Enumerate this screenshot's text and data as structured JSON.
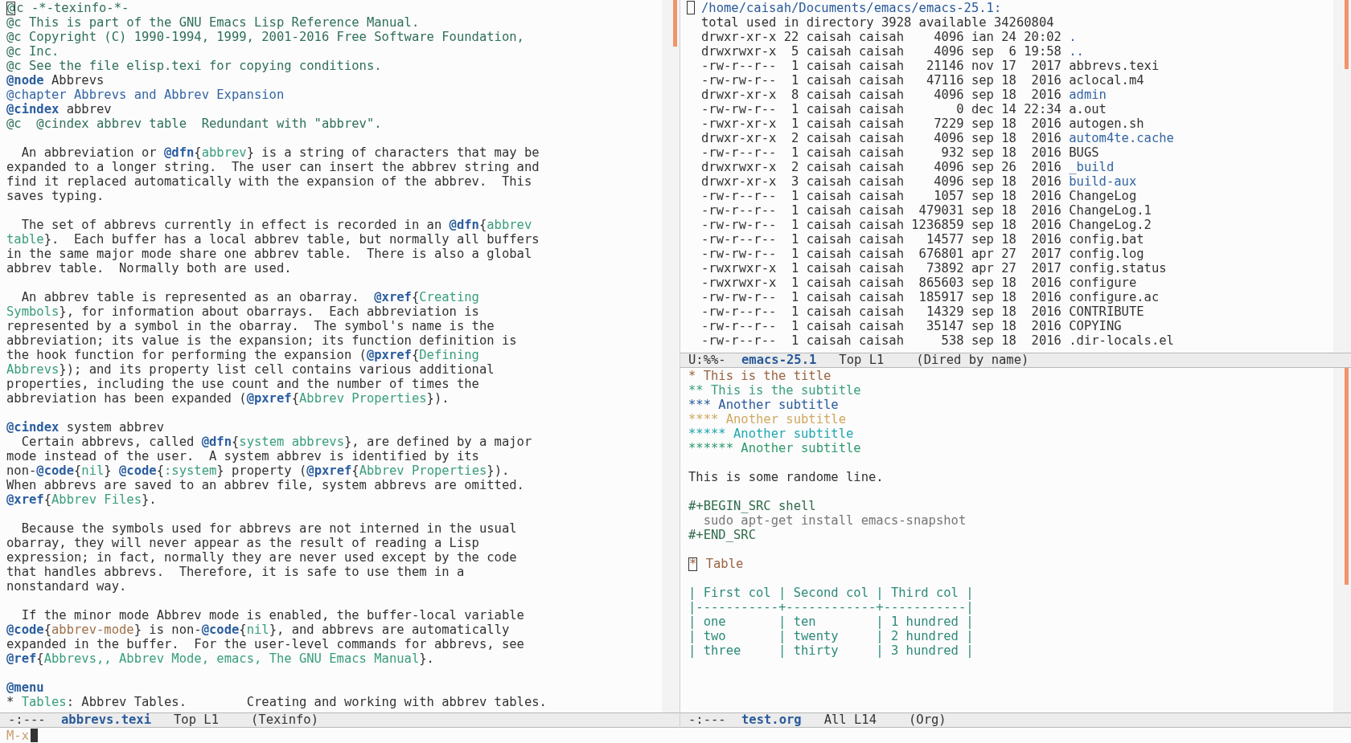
{
  "left": {
    "lines": [
      {
        "kind": "text",
        "segments": [
          {
            "kind": "cursor",
            "text": "@"
          },
          {
            "kind": "comment",
            "text": "c -*-texinfo-*-"
          }
        ]
      },
      {
        "kind": "text",
        "segments": [
          {
            "kind": "comment",
            "text": "@c This is part of the GNU Emacs Lisp Reference Manual."
          }
        ]
      },
      {
        "kind": "text",
        "segments": [
          {
            "kind": "comment",
            "text": "@c Copyright (C) 1990-1994, 1999, 2001-2016 Free Software Foundation,"
          }
        ]
      },
      {
        "kind": "text",
        "segments": [
          {
            "kind": "comment",
            "text": "@c Inc."
          }
        ]
      },
      {
        "kind": "text",
        "segments": [
          {
            "kind": "comment",
            "text": "@c See the file elisp.texi for copying conditions."
          }
        ]
      },
      {
        "kind": "text",
        "segments": [
          {
            "kind": "keyword",
            "text": "@node"
          },
          {
            "kind": "plain",
            "text": " Abbrevs"
          }
        ]
      },
      {
        "kind": "text",
        "segments": [
          {
            "kind": "heading",
            "text": "@chapter Abbrevs and Abbrev Expansion"
          }
        ]
      },
      {
        "kind": "text",
        "segments": [
          {
            "kind": "keyword",
            "text": "@cindex"
          },
          {
            "kind": "plain",
            "text": " abbrev"
          }
        ]
      },
      {
        "kind": "text",
        "segments": [
          {
            "kind": "comment",
            "text": "@c  @cindex abbrev table  Redundant with \"abbrev\"."
          }
        ]
      },
      {
        "kind": "blank"
      },
      {
        "kind": "text",
        "segments": [
          {
            "kind": "plain",
            "text": "  An abbreviation or "
          },
          {
            "kind": "keyword",
            "text": "@dfn"
          },
          {
            "kind": "plain",
            "text": "{"
          },
          {
            "kind": "arg",
            "text": "abbrev"
          },
          {
            "kind": "plain",
            "text": "} is a string of characters that may be"
          }
        ]
      },
      {
        "kind": "text",
        "segments": [
          {
            "kind": "plain",
            "text": "expanded to a longer string.  The user can insert the abbrev string and"
          }
        ]
      },
      {
        "kind": "text",
        "segments": [
          {
            "kind": "plain",
            "text": "find it replaced automatically with the expansion of the abbrev.  This"
          }
        ]
      },
      {
        "kind": "text",
        "segments": [
          {
            "kind": "plain",
            "text": "saves typing."
          }
        ]
      },
      {
        "kind": "blank"
      },
      {
        "kind": "text",
        "segments": [
          {
            "kind": "plain",
            "text": "  The set of abbrevs currently in effect is recorded in an "
          },
          {
            "kind": "keyword",
            "text": "@dfn"
          },
          {
            "kind": "plain",
            "text": "{"
          },
          {
            "kind": "arg",
            "text": "abbrev"
          }
        ]
      },
      {
        "kind": "text",
        "segments": [
          {
            "kind": "arg",
            "text": "table"
          },
          {
            "kind": "plain",
            "text": "}.  Each buffer has a local abbrev table, but normally all buffers"
          }
        ]
      },
      {
        "kind": "text",
        "segments": [
          {
            "kind": "plain",
            "text": "in the same major mode share one abbrev table.  There is also a global"
          }
        ]
      },
      {
        "kind": "text",
        "segments": [
          {
            "kind": "plain",
            "text": "abbrev table.  Normally both are used."
          }
        ]
      },
      {
        "kind": "blank"
      },
      {
        "kind": "text",
        "segments": [
          {
            "kind": "plain",
            "text": "  An abbrev table is represented as an obarray.  "
          },
          {
            "kind": "keyword",
            "text": "@xref"
          },
          {
            "kind": "plain",
            "text": "{"
          },
          {
            "kind": "arg",
            "text": "Creating"
          }
        ]
      },
      {
        "kind": "text",
        "segments": [
          {
            "kind": "arg",
            "text": "Symbols"
          },
          {
            "kind": "plain",
            "text": "}, for information about obarrays.  Each abbreviation is"
          }
        ]
      },
      {
        "kind": "text",
        "segments": [
          {
            "kind": "plain",
            "text": "represented by a symbol in the obarray.  The symbol's name is the"
          }
        ]
      },
      {
        "kind": "text",
        "segments": [
          {
            "kind": "plain",
            "text": "abbreviation; its value is the expansion; its function definition is"
          }
        ]
      },
      {
        "kind": "text",
        "segments": [
          {
            "kind": "plain",
            "text": "the hook function for performing the expansion ("
          },
          {
            "kind": "keyword",
            "text": "@pxref"
          },
          {
            "kind": "plain",
            "text": "{"
          },
          {
            "kind": "arg",
            "text": "Defining"
          }
        ]
      },
      {
        "kind": "text",
        "segments": [
          {
            "kind": "arg",
            "text": "Abbrevs"
          },
          {
            "kind": "plain",
            "text": "}); and its property list cell contains various additional"
          }
        ]
      },
      {
        "kind": "text",
        "segments": [
          {
            "kind": "plain",
            "text": "properties, including the use count and the number of times the"
          }
        ]
      },
      {
        "kind": "text",
        "segments": [
          {
            "kind": "plain",
            "text": "abbreviation has been expanded ("
          },
          {
            "kind": "keyword",
            "text": "@pxref"
          },
          {
            "kind": "plain",
            "text": "{"
          },
          {
            "kind": "arg",
            "text": "Abbrev Properties"
          },
          {
            "kind": "plain",
            "text": "})."
          }
        ]
      },
      {
        "kind": "blank"
      },
      {
        "kind": "text",
        "segments": [
          {
            "kind": "keyword",
            "text": "@cindex"
          },
          {
            "kind": "plain",
            "text": " system abbrev"
          }
        ]
      },
      {
        "kind": "text",
        "segments": [
          {
            "kind": "plain",
            "text": "  Certain abbrevs, called "
          },
          {
            "kind": "keyword",
            "text": "@dfn"
          },
          {
            "kind": "plain",
            "text": "{"
          },
          {
            "kind": "arg",
            "text": "system abbrevs"
          },
          {
            "kind": "plain",
            "text": "}, are defined by a major"
          }
        ]
      },
      {
        "kind": "text",
        "segments": [
          {
            "kind": "plain",
            "text": "mode instead of the user.  A system abbrev is identified by its"
          }
        ]
      },
      {
        "kind": "text",
        "segments": [
          {
            "kind": "plain",
            "text": "non-"
          },
          {
            "kind": "keyword",
            "text": "@code"
          },
          {
            "kind": "plain",
            "text": "{"
          },
          {
            "kind": "arg",
            "text": "nil"
          },
          {
            "kind": "plain",
            "text": "} "
          },
          {
            "kind": "keyword",
            "text": "@code"
          },
          {
            "kind": "plain",
            "text": "{"
          },
          {
            "kind": "arg",
            "text": ":system"
          },
          {
            "kind": "plain",
            "text": "} property ("
          },
          {
            "kind": "keyword",
            "text": "@pxref"
          },
          {
            "kind": "plain",
            "text": "{"
          },
          {
            "kind": "arg",
            "text": "Abbrev Properties"
          },
          {
            "kind": "plain",
            "text": "})."
          }
        ]
      },
      {
        "kind": "text",
        "segments": [
          {
            "kind": "plain",
            "text": "When abbrevs are saved to an abbrev file, system abbrevs are omitted."
          }
        ]
      },
      {
        "kind": "text",
        "segments": [
          {
            "kind": "keyword",
            "text": "@xref"
          },
          {
            "kind": "plain",
            "text": "{"
          },
          {
            "kind": "arg",
            "text": "Abbrev Files"
          },
          {
            "kind": "plain",
            "text": "}."
          }
        ]
      },
      {
        "kind": "blank"
      },
      {
        "kind": "text",
        "segments": [
          {
            "kind": "plain",
            "text": "  Because the symbols used for abbrevs are not interned in the usual"
          }
        ]
      },
      {
        "kind": "text",
        "segments": [
          {
            "kind": "plain",
            "text": "obarray, they will never appear as the result of reading a Lisp"
          }
        ]
      },
      {
        "kind": "text",
        "segments": [
          {
            "kind": "plain",
            "text": "expression; in fact, normally they are never used except by the code"
          }
        ]
      },
      {
        "kind": "text",
        "segments": [
          {
            "kind": "plain",
            "text": "that handles abbrevs.  Therefore, it is safe to use them in a"
          }
        ]
      },
      {
        "kind": "text",
        "segments": [
          {
            "kind": "plain",
            "text": "nonstandard way."
          }
        ]
      },
      {
        "kind": "blank"
      },
      {
        "kind": "text",
        "segments": [
          {
            "kind": "plain",
            "text": "  If the minor mode Abbrev mode is enabled, the buffer-local variable"
          }
        ]
      },
      {
        "kind": "text",
        "segments": [
          {
            "kind": "keyword",
            "text": "@code"
          },
          {
            "kind": "plain",
            "text": "{"
          },
          {
            "kind": "code",
            "text": "abbrev-mode"
          },
          {
            "kind": "plain",
            "text": "} is non-"
          },
          {
            "kind": "keyword",
            "text": "@code"
          },
          {
            "kind": "plain",
            "text": "{"
          },
          {
            "kind": "arg",
            "text": "nil"
          },
          {
            "kind": "plain",
            "text": "}, and abbrevs are automatically"
          }
        ]
      },
      {
        "kind": "text",
        "segments": [
          {
            "kind": "plain",
            "text": "expanded in the buffer.  For the user-level commands for abbrevs, see"
          }
        ]
      },
      {
        "kind": "text",
        "segments": [
          {
            "kind": "keyword",
            "text": "@ref"
          },
          {
            "kind": "plain",
            "text": "{"
          },
          {
            "kind": "arg",
            "text": "Abbrevs,, Abbrev Mode, emacs, The GNU Emacs Manual"
          },
          {
            "kind": "plain",
            "text": "}."
          }
        ]
      },
      {
        "kind": "blank"
      },
      {
        "kind": "text",
        "segments": [
          {
            "kind": "keyword",
            "text": "@menu"
          }
        ]
      },
      {
        "kind": "text",
        "segments": [
          {
            "kind": "plain",
            "text": "* "
          },
          {
            "kind": "arg",
            "text": "Tables"
          },
          {
            "kind": "plain",
            "text": ": Abbrev Tables.        Creating and working with abbrev tables."
          }
        ]
      }
    ],
    "mode_line": {
      "status": "-:---",
      "buffer": "abbrevs.texi",
      "position": "Top L1",
      "mode": "(Texinfo)"
    }
  },
  "dired": {
    "header": {
      "path": "/home/caisah/Documents/emacs/emacs-25.1:",
      "cursor": true
    },
    "total": "total used in directory 3928 available 34260804",
    "entries": [
      {
        "details": "drwxr-xr-x 22 caisah caisah    4096 ian 24 20:02 ",
        "name": ".",
        "kind": "dir"
      },
      {
        "details": "drwxrwxr-x  5 caisah caisah    4096 sep  6 19:58 ",
        "name": "..",
        "kind": "dir"
      },
      {
        "details": "-rw-r--r--  1 caisah caisah   21146 nov 17  2017 ",
        "name": "abbrevs.texi",
        "kind": "file"
      },
      {
        "details": "-rw-rw-r--  1 caisah caisah   47116 sep 18  2016 ",
        "name": "aclocal.m4",
        "kind": "file"
      },
      {
        "details": "drwxr-xr-x  8 caisah caisah    4096 sep 18  2016 ",
        "name": "admin",
        "kind": "dir"
      },
      {
        "details": "-rw-rw-r--  1 caisah caisah       0 dec 14 22:34 ",
        "name": "a.out",
        "kind": "file"
      },
      {
        "details": "-rwxr-xr-x  1 caisah caisah    7229 sep 18  2016 ",
        "name": "autogen.sh",
        "kind": "file"
      },
      {
        "details": "drwxr-xr-x  2 caisah caisah    4096 sep 18  2016 ",
        "name": "autom4te.cache",
        "kind": "dir"
      },
      {
        "details": "-rw-r--r--  1 caisah caisah     932 sep 18  2016 ",
        "name": "BUGS",
        "kind": "file"
      },
      {
        "details": "drwxrwxr-x  2 caisah caisah    4096 sep 26  2016 ",
        "name": "_build",
        "kind": "dir"
      },
      {
        "details": "drwxr-xr-x  3 caisah caisah    4096 sep 18  2016 ",
        "name": "build-aux",
        "kind": "dir"
      },
      {
        "details": "-rw-r--r--  1 caisah caisah    1057 sep 18  2016 ",
        "name": "ChangeLog",
        "kind": "file"
      },
      {
        "details": "-rw-r--r--  1 caisah caisah  479031 sep 18  2016 ",
        "name": "ChangeLog.1",
        "kind": "file"
      },
      {
        "details": "-rw-rw-r--  1 caisah caisah 1236859 sep 18  2016 ",
        "name": "ChangeLog.2",
        "kind": "file"
      },
      {
        "details": "-rw-r--r--  1 caisah caisah   14577 sep 18  2016 ",
        "name": "config.bat",
        "kind": "file"
      },
      {
        "details": "-rw-rw-r--  1 caisah caisah  676801 apr 27  2017 ",
        "name": "config.log",
        "kind": "file"
      },
      {
        "details": "-rwxrwxr-x  1 caisah caisah   73892 apr 27  2017 ",
        "name": "config.status",
        "kind": "file"
      },
      {
        "details": "-rwxrwxr-x  1 caisah caisah  865603 sep 18  2016 ",
        "name": "configure",
        "kind": "file"
      },
      {
        "details": "-rw-rw-r--  1 caisah caisah  185917 sep 18  2016 ",
        "name": "configure.ac",
        "kind": "file"
      },
      {
        "details": "-rw-r--r--  1 caisah caisah   14329 sep 18  2016 ",
        "name": "CONTRIBUTE",
        "kind": "file"
      },
      {
        "details": "-rw-r--r--  1 caisah caisah   35147 sep 18  2016 ",
        "name": "COPYING",
        "kind": "file"
      },
      {
        "details": "-rw-r--r--  1 caisah caisah     538 sep 18  2016 ",
        "name": ".dir-locals.el",
        "kind": "file"
      }
    ],
    "mode_line": {
      "status": "U:%%-",
      "buffer": "emacs-25.1",
      "position": "Top L1",
      "mode": "(Dired by name)"
    }
  },
  "org": {
    "lines": [
      {
        "kind": "h1",
        "text": "* This is the title"
      },
      {
        "kind": "h2",
        "text": "** This is the subtitle"
      },
      {
        "kind": "h3",
        "text": "*** Another subtitle"
      },
      {
        "kind": "h4",
        "text": "**** Another subtitle"
      },
      {
        "kind": "h5",
        "text": "***** Another subtitle"
      },
      {
        "kind": "h6",
        "text": "****** Another subtitle"
      },
      {
        "kind": "blank"
      },
      {
        "kind": "plain",
        "text": "This is some randome line."
      },
      {
        "kind": "blank"
      },
      {
        "kind": "meta",
        "text": "#+BEGIN_SRC shell"
      },
      {
        "kind": "src",
        "text": "  sudo apt-get install emacs-snapshot"
      },
      {
        "kind": "meta",
        "text": "#+END_SRC"
      },
      {
        "kind": "blank"
      },
      {
        "kind": "h1",
        "cursor_char": "*",
        "text": " Table"
      },
      {
        "kind": "blank"
      },
      {
        "kind": "table",
        "text": "| First col | Second col | Third col |"
      },
      {
        "kind": "table",
        "text": "|-----------+------------+-----------|"
      },
      {
        "kind": "table",
        "text": "| one       | ten        | 1 hundred |"
      },
      {
        "kind": "table",
        "text": "| two       | twenty     | 2 hundred |"
      },
      {
        "kind": "table",
        "text": "| three     | thirty     | 3 hundred |"
      }
    ],
    "mode_line": {
      "status": "-:---",
      "buffer": "test.org",
      "position": "All L14",
      "mode": "(Org)"
    }
  },
  "minibuffer": {
    "prompt": "M-x"
  }
}
